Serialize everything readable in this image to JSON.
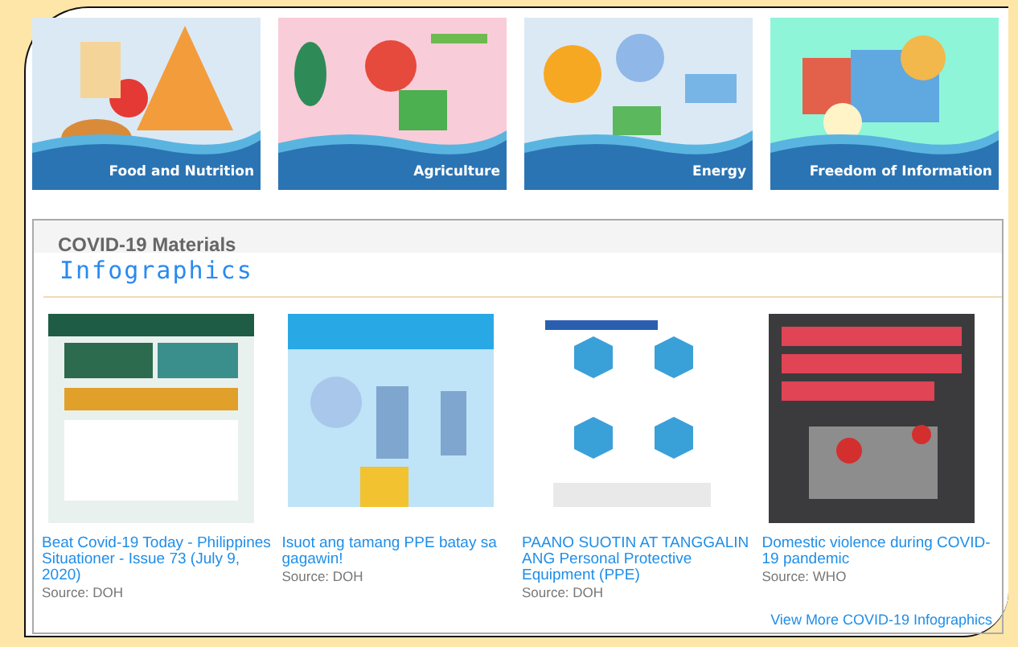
{
  "topics": [
    {
      "label": "Food and Nutrition"
    },
    {
      "label": "Agriculture"
    },
    {
      "label": "Energy"
    },
    {
      "label": "Freedom of Information"
    }
  ],
  "materials": {
    "heading": "COVID-19 Materials",
    "subheading": "Infographics",
    "items": [
      {
        "title": "Beat Covid-19 Today - Philippines Situationer - Issue 73 (July 9, 2020)",
        "source": "Source: DOH"
      },
      {
        "title": "Isuot ang tamang PPE batay sa gagawin!",
        "source": "Source: DOH"
      },
      {
        "title": "PAANO SUOTIN AT TANGGALIN ANG Personal Protective Equipment (PPE)",
        "source": "Source: DOH"
      },
      {
        "title": "Domestic violence during COVID-19 pandemic",
        "source": "Source: WHO"
      }
    ],
    "more_link": "View More COVID-19 Infographics"
  }
}
